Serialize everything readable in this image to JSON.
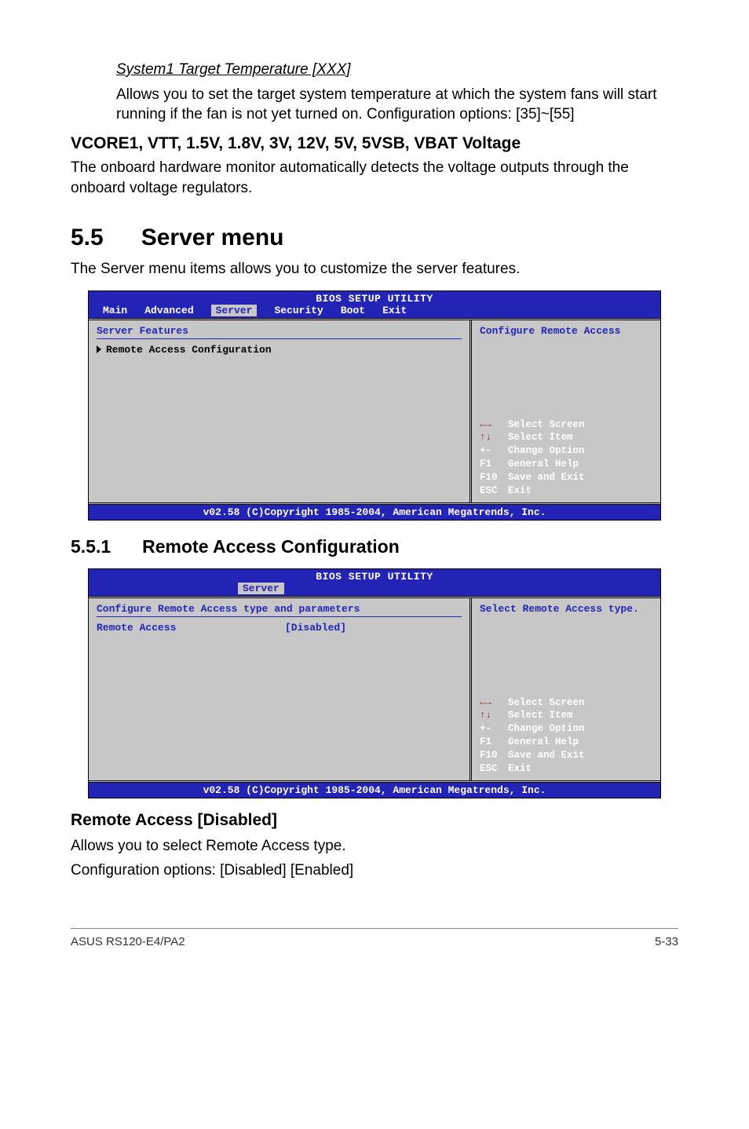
{
  "top": {
    "subhead": "System1 Target Temperature [XXX]",
    "desc": "Allows you to set the target system temperature at which the system fans will start running if the fan is not yet turned on. Configuration options: [35]~[55]",
    "vcore_title": "VCORE1, VTT, 1.5V, 1.8V, 3V, 12V, 5V, 5VSB, VBAT Voltage",
    "vcore_desc": "The onboard hardware monitor automatically detects the voltage outputs through the onboard voltage regulators."
  },
  "sec55": {
    "num": "5.5",
    "title": "Server menu",
    "desc": "The Server menu items allows you to customize the server features."
  },
  "bios1": {
    "title": "BIOS SETUP UTILITY",
    "tabs": [
      "Main",
      "Advanced",
      "Server",
      "Security",
      "Boot",
      "Exit"
    ],
    "active_tab": "Server",
    "left_title": "Server Features",
    "menu_item": "Remote Access Configuration",
    "right_text": "Configure Remote Access",
    "keys": {
      "k1": "Select Screen",
      "k2": "Select Item",
      "k3l": "+-",
      "k3": "Change Option",
      "k4l": "F1",
      "k4": "General Help",
      "k5l": "F10",
      "k5": "Save and Exit",
      "k6l": "ESC",
      "k6": "Exit"
    },
    "footer": "v02.58 (C)Copyright 1985-2004, American Megatrends, Inc."
  },
  "sec551": {
    "num": "5.5.1",
    "title": "Remote Access Configuration"
  },
  "bios2": {
    "title": "BIOS SETUP UTILITY",
    "active_tab": "Server",
    "left_title": "Configure Remote Access type and parameters",
    "kv_key": "Remote Access",
    "kv_val": "[Disabled]",
    "right_text": "Select Remote Access type.",
    "keys": {
      "k1": "Select Screen",
      "k2": "Select Item",
      "k3l": "+-",
      "k3": "Change Option",
      "k4l": "F1",
      "k4": "General Help",
      "k5l": "F10",
      "k5": "Save and Exit",
      "k6l": "ESC",
      "k6": "Exit"
    },
    "footer": "v02.58 (C)Copyright 1985-2004, American Megatrends, Inc."
  },
  "remote": {
    "title": "Remote Access [Disabled]",
    "l1": "Allows you to select Remote Access type.",
    "l2": "Configuration options: [Disabled] [Enabled]"
  },
  "footer": {
    "left": "ASUS RS120-E4/PA2",
    "right": "5-33"
  }
}
